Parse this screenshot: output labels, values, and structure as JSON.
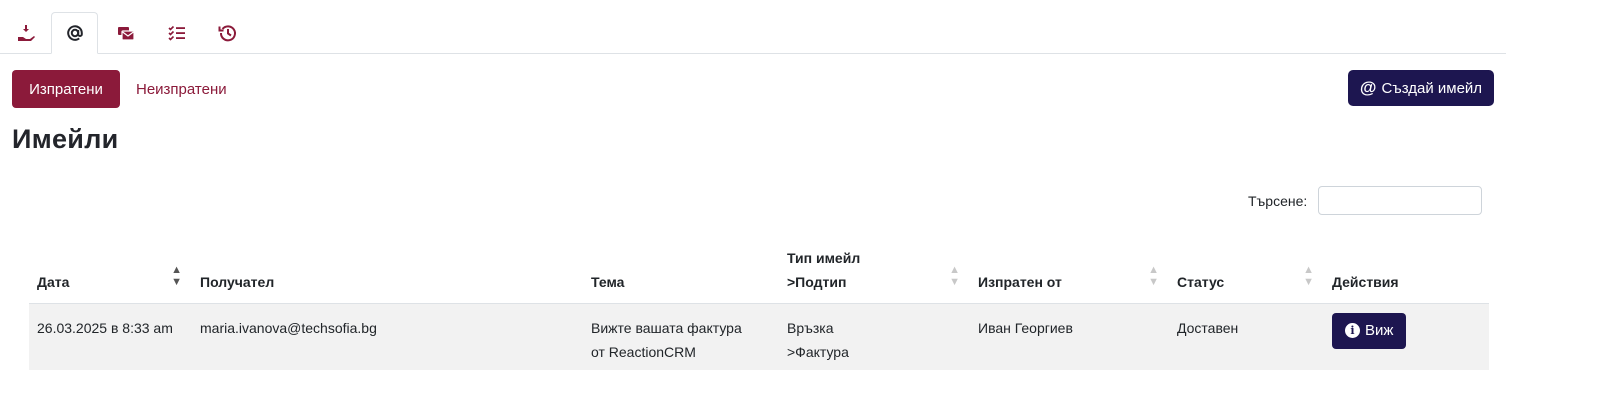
{
  "tabs": [
    {
      "icon": "hand-coin-icon",
      "active": false
    },
    {
      "icon": "at-sign-icon",
      "active": true
    },
    {
      "icon": "envelopes-icon",
      "active": false
    },
    {
      "icon": "task-list-icon",
      "active": false
    },
    {
      "icon": "history-icon",
      "active": false
    }
  ],
  "pills": {
    "sent": "Изпратени",
    "unsent": "Неизпратени"
  },
  "create_button": {
    "icon": "@",
    "label": "Създай имейл"
  },
  "page_title": "Имейли",
  "search": {
    "label": "Търсене:",
    "value": "",
    "placeholder": ""
  },
  "table": {
    "headers": {
      "date": "Дата",
      "recipient": "Получател",
      "subject": "Тема",
      "type_line1": "Тип имейл",
      "type_line2": ">Подтип",
      "sent_by": "Изпратен от",
      "status": "Статус",
      "actions": "Действия"
    },
    "rows": [
      {
        "date": "26.03.2025 в 8:33 am",
        "recipient": "maria.ivanova@techsofia.bg",
        "subject_line1": "Вижте вашата фактура",
        "subject_line2": "от ReactionCRM",
        "type_line1": "Връзка",
        "type_line2": ">Фактура",
        "sent_by": "Иван Георгиев",
        "status": "Доставен",
        "action_label": "Виж"
      }
    ]
  },
  "colors": {
    "primary": "#8b1a3a",
    "dark_navy": "#1d1650",
    "row_bg": "#f2f2f2"
  }
}
